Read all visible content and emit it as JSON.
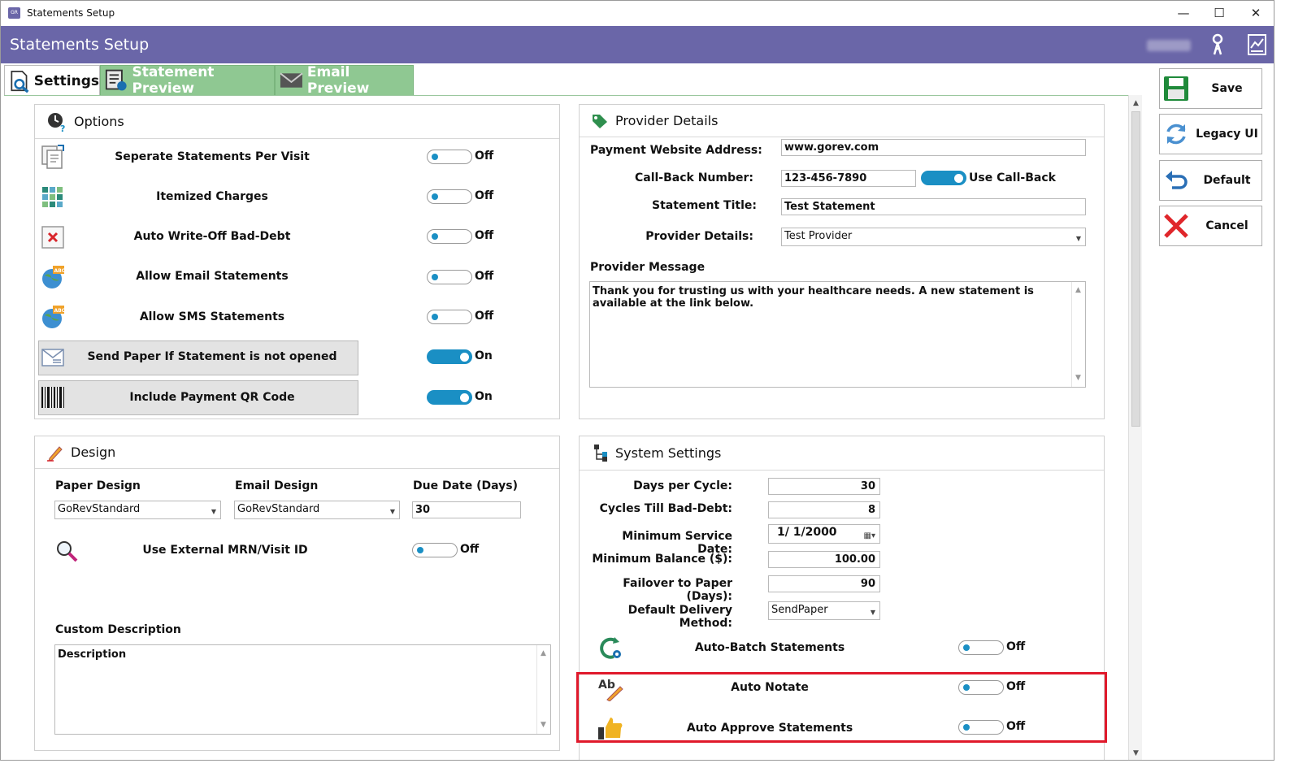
{
  "window": {
    "title": "Statements Setup",
    "app_icon_text": "GR",
    "controls": {
      "minimize": "—",
      "maximize": "☐",
      "close": "✕"
    }
  },
  "header": {
    "title": "Statements Setup",
    "icons": [
      "keys-icon",
      "report-icon"
    ]
  },
  "tabs": [
    {
      "label": "Settings",
      "active": true
    },
    {
      "label": "Statement Preview",
      "active": false
    },
    {
      "label": "Email Preview",
      "active": false
    }
  ],
  "options": {
    "title": "Options",
    "items": [
      {
        "label": "Seperate Statements Per Visit",
        "state": "Off",
        "icon": "document-copy-icon"
      },
      {
        "label": "Itemized Charges",
        "state": "Off",
        "icon": "grid-icon"
      },
      {
        "label": "Auto Write-Off Bad-Debt",
        "state": "Off",
        "icon": "delete-document-icon"
      },
      {
        "label": "Allow Email Statements",
        "state": "Off",
        "icon": "globe-abc-icon"
      },
      {
        "label": "Allow SMS Statements",
        "state": "Off",
        "icon": "globe-abc-icon"
      },
      {
        "label": "Send Paper If Statement is not opened",
        "state": "On",
        "icon": "letter-icon"
      },
      {
        "label": "Include Payment QR Code",
        "state": "On",
        "icon": "barcode-icon"
      }
    ]
  },
  "provider": {
    "title": "Provider Details",
    "website_label": "Payment Website Address:",
    "website_value": "www.gorev.com",
    "callback_label": "Call-Back Number:",
    "callback_value": "123-456-7890",
    "use_callback_label": "Use Call-Back",
    "statement_title_label": "Statement Title:",
    "statement_title_value": "Test Statement",
    "provider_details_label": "Provider Details:",
    "provider_details_value": "Test Provider",
    "message_label": "Provider Message",
    "message_value": "Thank you for trusting us with your healthcare needs.  A new statement is available at the link below."
  },
  "design": {
    "title": "Design",
    "paper_label": "Paper Design",
    "paper_value": "GoRevStandard",
    "email_label": "Email Design",
    "email_value": "GoRevStandard",
    "due_label": "Due Date (Days)",
    "due_value": "30",
    "external_label": "Use External MRN/Visit ID",
    "external_state": "Off",
    "custom_label": "Custom Description",
    "custom_value": "Description"
  },
  "system": {
    "title": "System Settings",
    "fields": [
      {
        "label": "Days per Cycle:",
        "value": "30"
      },
      {
        "label": "Cycles Till Bad-Debt:",
        "value": "8"
      },
      {
        "label": "Minimum Service Date:",
        "value": "1/  1/2000"
      },
      {
        "label": "Minimum Balance ($):",
        "value": "100.00"
      },
      {
        "label": "Failover to Paper (Days):",
        "value": "90"
      },
      {
        "label": "Default Delivery Method:",
        "value": "SendPaper"
      }
    ],
    "toggles": [
      {
        "label": "Auto-Batch Statements",
        "state": "Off",
        "icon": "refresh-gear-icon"
      },
      {
        "label": "Auto Notate",
        "state": "Off",
        "icon": "abc-pencil-icon"
      },
      {
        "label": "Auto Approve Statements",
        "state": "Off",
        "icon": "thumbs-up-icon"
      }
    ]
  },
  "actions": {
    "save": "Save",
    "legacy": "Legacy UI",
    "default": "Default",
    "cancel": "Cancel"
  },
  "colors": {
    "header": "#6a66a8",
    "toggle_on": "#1a8fc4",
    "tab_inactive": "#8fc892",
    "highlight": "#e0192b"
  }
}
